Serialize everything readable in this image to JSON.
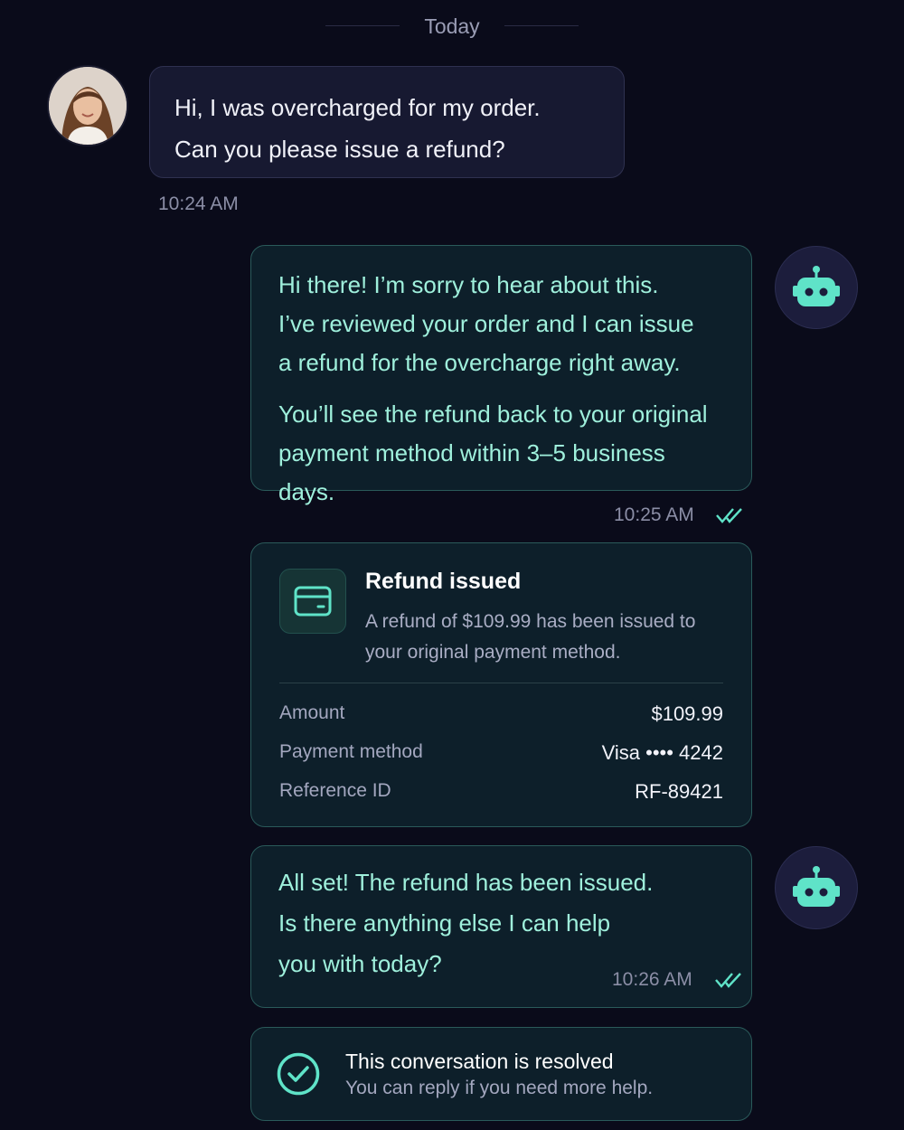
{
  "day_separator": "Today",
  "messages": {
    "user1": {
      "lines": [
        "Hi, I was overcharged for my order.",
        "Can you please issue a refund?"
      ],
      "time": "10:24 AM"
    },
    "bot1": {
      "paragraphs": [
        [
          "Hi there! I’m sorry to hear about this.",
          "I’ve reviewed your order and I can issue",
          "a refund for the overcharge right away."
        ],
        [
          "You’ll see the refund back to your original",
          "payment method within 3–5 business days."
        ]
      ],
      "time": "10:25 AM"
    },
    "bot2": {
      "lines": [
        "All set! The refund has been issued.",
        "Is there anything else I can help",
        "you with today?"
      ],
      "time": "10:26 AM"
    }
  },
  "refund_card": {
    "icon": "credit-card-icon",
    "title": "Refund issued",
    "description_lines": [
      "A refund of $109.99 has been issued to",
      "your original payment method."
    ],
    "rows": [
      {
        "label": "Amount",
        "value": "$109.99"
      },
      {
        "label": "Payment method",
        "value": "Visa •••• 4242"
      },
      {
        "label": "Reference ID",
        "value": "RF-89421"
      }
    ]
  },
  "resolved_banner": {
    "icon": "check-circle-icon",
    "title": "This conversation is resolved",
    "subtitle": "You can reply if you need more help."
  },
  "colors": {
    "background": "#0a0b1a",
    "accent": "#5fe3c8",
    "bot_text": "#9ff0dc"
  }
}
